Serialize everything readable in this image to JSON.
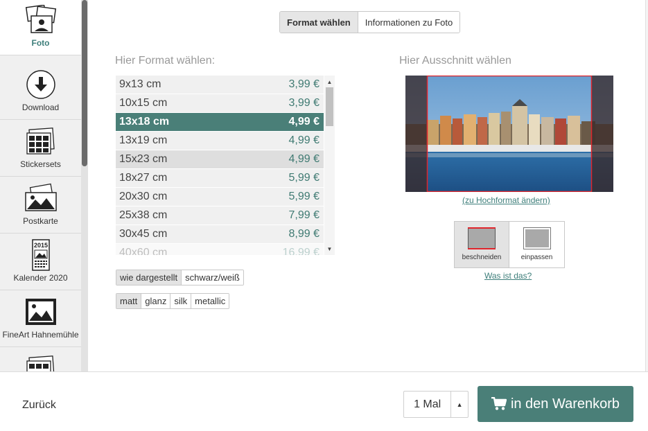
{
  "sidebar": {
    "items": [
      {
        "label": "Foto",
        "icon": "photo-stack-icon"
      },
      {
        "label": "Download",
        "icon": "download-icon"
      },
      {
        "label": "Stickersets",
        "icon": "sticker-sheet-icon"
      },
      {
        "label": "Postkarte",
        "icon": "postcard-icon"
      },
      {
        "label": "Kalender 2020",
        "icon": "calendar-icon",
        "icon_text": "2015"
      },
      {
        "label": "FineArt Hahnemühle",
        "icon": "framed-picture-icon"
      }
    ]
  },
  "tabs": [
    {
      "label": "Format wählen",
      "active": true
    },
    {
      "label": "Informationen zu Foto",
      "active": false
    }
  ],
  "format_section": {
    "title": "Hier Format wählen:",
    "formats": [
      {
        "size": "9x13 cm",
        "price": "3,99 €"
      },
      {
        "size": "10x15 cm",
        "price": "3,99 €"
      },
      {
        "size": "13x18 cm",
        "price": "4,99 €",
        "selected": true
      },
      {
        "size": "13x19 cm",
        "price": "4,99 €"
      },
      {
        "size": "15x23 cm",
        "price": "4,99 €",
        "hover": true
      },
      {
        "size": "18x27 cm",
        "price": "5,99 €"
      },
      {
        "size": "20x30 cm",
        "price": "5,99 €"
      },
      {
        "size": "25x38 cm",
        "price": "7,99 €"
      },
      {
        "size": "30x45 cm",
        "price": "8,99 €"
      },
      {
        "size": "40x60 cm",
        "price": "16,99 €"
      }
    ]
  },
  "color_options": [
    {
      "label": "wie dargestellt",
      "active": true
    },
    {
      "label": "schwarz/weiß",
      "active": false
    }
  ],
  "paper_options": [
    {
      "label": "matt",
      "active": true
    },
    {
      "label": "glanz",
      "active": false
    },
    {
      "label": "silk",
      "active": false
    },
    {
      "label": "metallic",
      "active": false
    }
  ],
  "crop_section": {
    "title": "Hier Ausschnitt wählen",
    "orientation_link": "(zu Hochformat ändern)",
    "fit_options": [
      {
        "label": "beschneiden",
        "active": true
      },
      {
        "label": "einpassen",
        "active": false
      }
    ],
    "help_link": "Was ist das?"
  },
  "footer": {
    "back_label": "Zurück",
    "quantity": "1 Mal",
    "cart_label": "in den Warenkorb"
  },
  "colors": {
    "accent": "#4a7f78",
    "crop_frame": "#e0242b"
  }
}
